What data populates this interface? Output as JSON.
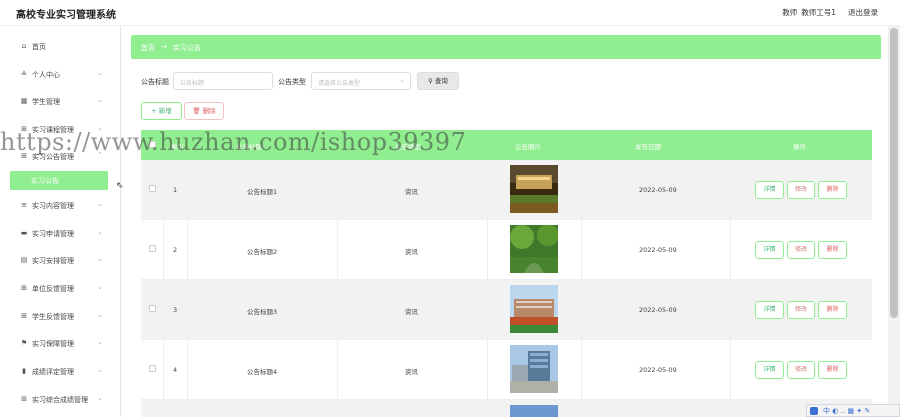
{
  "app": {
    "title": "高校专业实习管理系统"
  },
  "topbar": {
    "role": "教师",
    "user": "教师工号1",
    "logout": "退出登录"
  },
  "sidebar": {
    "items": [
      {
        "label": "首页",
        "icon": "home-icon",
        "glyph": "⌂"
      },
      {
        "label": "个人中心",
        "icon": "user-icon",
        "glyph": "≗"
      },
      {
        "label": "学生管理",
        "icon": "grid-icon",
        "glyph": "▦"
      },
      {
        "label": "实习课程管理",
        "icon": "grid-icon",
        "glyph": "⊞"
      },
      {
        "label": "实习公告管理",
        "icon": "grid-icon",
        "glyph": "⊞"
      },
      {
        "label": "实习内容管理",
        "icon": "list-icon",
        "glyph": "≡"
      },
      {
        "label": "实习申请管理",
        "icon": "bookmark-icon",
        "glyph": "▬"
      },
      {
        "label": "实习安排管理",
        "icon": "calendar-icon",
        "glyph": "▤"
      },
      {
        "label": "单位反馈管理",
        "icon": "grid-icon",
        "glyph": "⊞"
      },
      {
        "label": "学生反馈管理",
        "icon": "grid-icon",
        "glyph": "⊞"
      },
      {
        "label": "实习保障管理",
        "icon": "flag-icon",
        "glyph": "⚑"
      },
      {
        "label": "成绩评定管理",
        "icon": "bar-chart-icon",
        "glyph": "▮"
      },
      {
        "label": "实习综合成绩管理",
        "icon": "grid-icon",
        "glyph": "⊞"
      }
    ],
    "submenu": {
      "label": "实习公告"
    }
  },
  "breadcrumb": {
    "home": "首页",
    "arrow": "→",
    "current": "实习公告"
  },
  "search": {
    "title_label": "公告标题",
    "title_placeholder": "公告标题",
    "type_label": "公告类型",
    "type_placeholder": "请选择公告类型",
    "query_button": "查询"
  },
  "toolbar": {
    "add_button": "新增",
    "delete_button": "删除"
  },
  "table": {
    "headers": {
      "index": "索引",
      "title": "公告标题",
      "type": "公告类型",
      "image": "公告图片",
      "date": "发布日期",
      "actions": "操作"
    },
    "rows": [
      {
        "index": "1",
        "title": "公告标题1",
        "type": "资讯",
        "date": "2022-05-09"
      },
      {
        "index": "2",
        "title": "公告标题2",
        "type": "资讯",
        "date": "2022-05-09"
      },
      {
        "index": "3",
        "title": "公告标题3",
        "type": "资讯",
        "date": "2022-05-09"
      },
      {
        "index": "4",
        "title": "公告标题4",
        "type": "资讯",
        "date": "2022-05-09"
      }
    ],
    "actions": {
      "detail": "详情",
      "edit": "修改",
      "remove": "删除"
    }
  },
  "watermark": "https://www.huzhan.com/ishop39397",
  "ime_bar": "中 ◐ ‥ ▦ ✦ ✎",
  "colors": {
    "accent": "#90ee90",
    "danger": "#e06060"
  }
}
